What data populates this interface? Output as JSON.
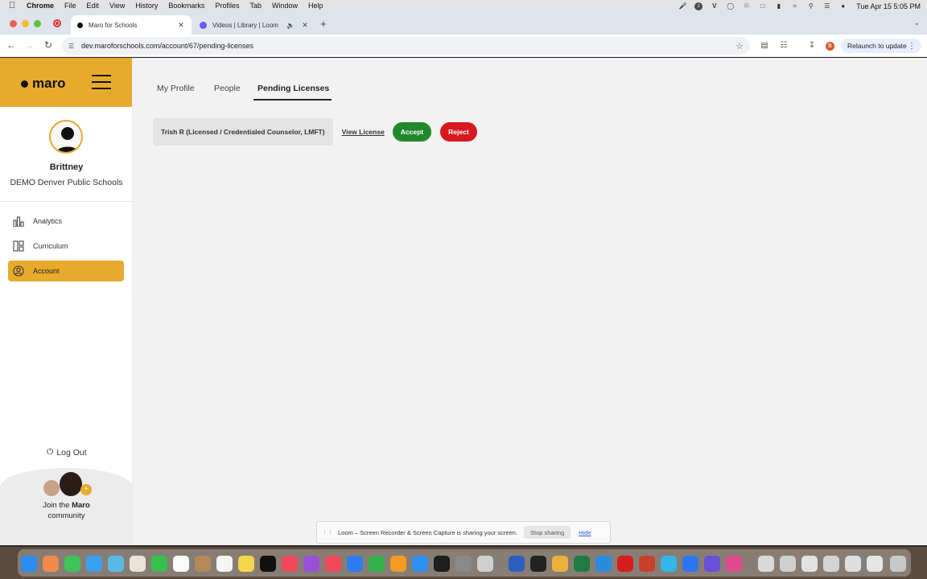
{
  "menubar": {
    "app": "Chrome",
    "items": [
      "File",
      "Edit",
      "View",
      "History",
      "Bookmarks",
      "Profiles",
      "Tab",
      "Window",
      "Help"
    ],
    "clock": "Tue Apr 15  5:05 PM"
  },
  "browser": {
    "tabs": [
      {
        "title": "Maro for Schools",
        "active": true
      },
      {
        "title": "Videos | Library | Loom",
        "active": false
      }
    ],
    "url": "dev.maroforschools.com/account/67/pending-licenses",
    "profile_initial": "B",
    "relaunch_label": "Relaunch to update"
  },
  "sidebar": {
    "logo_text": "maro",
    "user_name": "Brittney",
    "org_name": "DEMO Denver Public Schools",
    "nav": [
      {
        "label": "Analytics",
        "icon": "bar-chart-icon",
        "active": false
      },
      {
        "label": "Curriculum",
        "icon": "layout-icon",
        "active": false
      },
      {
        "label": "Account",
        "icon": "user-circle-icon",
        "active": true
      }
    ],
    "logout_label": "Log Out",
    "community_label_prefix": "Join the ",
    "community_label_brand": "Maro",
    "community_label_suffix": "community"
  },
  "main": {
    "tabs": [
      {
        "label": "My Profile",
        "active": false
      },
      {
        "label": "People",
        "active": false
      },
      {
        "label": "Pending Licenses",
        "active": true
      }
    ],
    "pending": [
      {
        "name": "Trish R (Licensed / Credentialed Counselor, LMFT)",
        "view_label": "View License",
        "accept_label": "Accept",
        "reject_label": "Reject"
      }
    ]
  },
  "loom_bar": {
    "message": "Loom – Screen Recorder & Screen Capture is sharing your screen.",
    "stop_label": "Stop sharing",
    "hide_label": "Hide"
  },
  "colors": {
    "brand": "#e8aa2d",
    "accept": "#22882c",
    "reject": "#d7191f"
  }
}
